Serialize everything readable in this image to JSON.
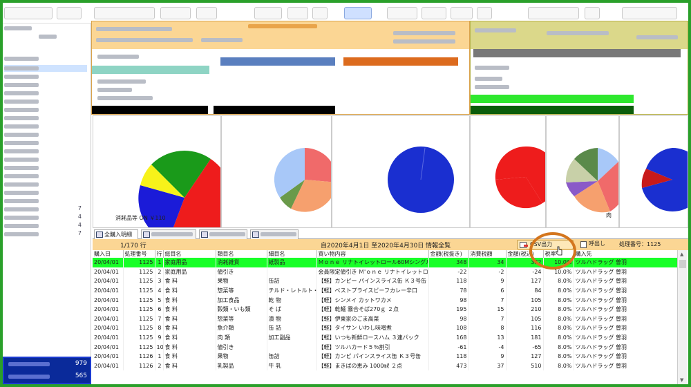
{
  "left_panel": {
    "list_counts": [
      "7",
      "4",
      "4",
      "7"
    ],
    "footer_values": [
      "979",
      "565"
    ]
  },
  "charts": {
    "caption_left": "消耗品等 ON ￥110",
    "caption_right": "肉"
  },
  "tabs": [
    {
      "label": "全購入明細"
    },
    {
      "label": ""
    },
    {
      "label": ""
    },
    {
      "label": ""
    }
  ],
  "status": {
    "row_count": "1/170 行",
    "period": "自2020年4月1日 至2020年4月30日 情報全覧",
    "csv_button": "CSV出力",
    "call_button": "呼出し",
    "process_no": "処理番号：1125"
  },
  "table": {
    "columns": [
      "購入日",
      "処理番号",
      "行",
      "総目名",
      "類目名",
      "細目名",
      "買い物内容",
      "金額(税抜き)",
      "消費税額",
      "金額(税込)",
      "税率",
      "購入先"
    ],
    "rows": [
      [
        "20/04/01",
        "1125",
        "1",
        "家庭用品",
        "消耗雑貨",
        "紙製品",
        "Ｍｏｎｅ リナトイレットロール60Mシングル 12",
        "348",
        "34",
        "382",
        "10.0%",
        "ツルハドラッグ 曽羽"
      ],
      [
        "20/04/01",
        "1125",
        "2",
        "家庭用品",
        "値引き",
        "",
        "会員限定値引き Ｍ'ｏｎｅ リナトイレットロー",
        "-22",
        "-2",
        "-24",
        "10.0%",
        "ツルハドラッグ 曽羽"
      ],
      [
        "20/04/01",
        "1125",
        "3",
        "食 料",
        "果物",
        "缶詰",
        "【軽】カンピー パインスライス缶 Ｋ３号缶",
        "118",
        "9",
        "127",
        "8.0%",
        "ツルハドラッグ 曽羽"
      ],
      [
        "20/04/01",
        "1125",
        "4",
        "食 料",
        "惣菜等",
        "チルド・レトルト・パウチ",
        "【軽】ベストプライスビーフカレー辛口",
        "78",
        "6",
        "84",
        "8.0%",
        "ツルハドラッグ 曽羽"
      ],
      [
        "20/04/01",
        "1125",
        "5",
        "食 料",
        "加工食品",
        "乾 物",
        "【軽】シンメイ カットワカメ",
        "98",
        "7",
        "105",
        "8.0%",
        "ツルハドラッグ 曽羽"
      ],
      [
        "20/04/01",
        "1125",
        "6",
        "食 料",
        "穀類・いも類",
        "そ ば",
        "【軽】乾麺 霧合そば270ｇ ２点",
        "195",
        "15",
        "210",
        "8.0%",
        "ツルハドラッグ 曽羽"
      ],
      [
        "20/04/01",
        "1125",
        "7",
        "食 料",
        "惣菜等",
        "漬 物",
        "【軽】伊東家のごま高菜",
        "98",
        "7",
        "105",
        "8.0%",
        "ツルハドラッグ 曽羽"
      ],
      [
        "20/04/01",
        "1125",
        "8",
        "食 料",
        "魚介類",
        "缶 詰",
        "【軽】タイサン いわし味噌煮",
        "108",
        "8",
        "116",
        "8.0%",
        "ツルハドラッグ 曽羽"
      ],
      [
        "20/04/01",
        "1125",
        "9",
        "食 料",
        "肉 類",
        "加工副品",
        "【軽】いつも新鮮ロースハム ３連パック",
        "168",
        "13",
        "181",
        "8.0%",
        "ツルハドラッグ 曽羽"
      ],
      [
        "20/04/01",
        "1125",
        "10",
        "食 料",
        "値引き",
        "",
        "【軽】ツルハカード５％割引",
        "-61",
        "-4",
        "-65",
        "8.0%",
        "ツルハドラッグ 曽羽"
      ],
      [
        "20/04/01",
        "1126",
        "1",
        "食 料",
        "果物",
        "缶詰",
        "【軽】カンピ パインスライス缶 Ｋ３号缶",
        "118",
        "9",
        "127",
        "8.0%",
        "ツルハドラッグ 曽羽"
      ],
      [
        "20/04/01",
        "1126",
        "2",
        "食 料",
        "乳製品",
        "牛 乳",
        "【軽】まきばの恵み 1000㎖ ２点",
        "473",
        "37",
        "510",
        "8.0%",
        "ツルハドラッグ 曽羽"
      ]
    ]
  },
  "colors": {
    "highlight_row": "#18ff28",
    "orange_band": "#fbd694",
    "olive_band": "#dbd88a",
    "window_border": "#2aa02a"
  },
  "icons": [
    "table-icon",
    "csv-export-icon",
    "call-icon",
    "cursor-hand-icon"
  ]
}
